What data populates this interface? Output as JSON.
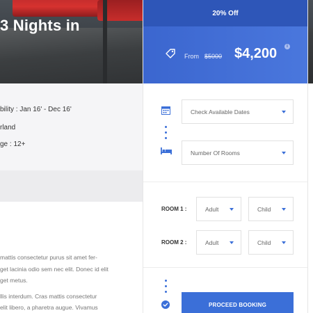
{
  "hero": {
    "title": "3 Nights in"
  },
  "details": {
    "availability": "bility : Jan 16' - Dec 16'",
    "location": "rland",
    "age": "ge : 12+"
  },
  "description": {
    "lines_1": [
      "mattis consectetur purus sit amet fer-",
      "get lacinia odio sem nec elit. Donec id elit",
      "get metus."
    ],
    "lines_2": [
      "llis interdum. Cras mattis consectetur",
      "elit libero, a pharetra augue. Vivamus"
    ]
  },
  "booking": {
    "discount": "20% Off",
    "from_label": "From",
    "old_price": "$5000",
    "new_price": "$4,200",
    "info_glyph": "i",
    "dates_select": "Check Available Dates",
    "rooms_select": "Number Of Rooms",
    "rooms": [
      {
        "label": "ROOM 1 :",
        "adult": "Adult",
        "child": "Child"
      },
      {
        "label": "ROOM 2 :",
        "adult": "Adult",
        "child": "Child"
      }
    ],
    "proceed_label": "PROCEED BOOKING"
  },
  "colors": {
    "accent": "#3b6fd8",
    "discount_bg": "#2e56b8",
    "price_bg": "#4a77dd"
  },
  "icons": [
    "tag-icon",
    "info-icon",
    "calendar-icon",
    "bed-icon",
    "check-circle-icon",
    "chevron-down-icon"
  ]
}
